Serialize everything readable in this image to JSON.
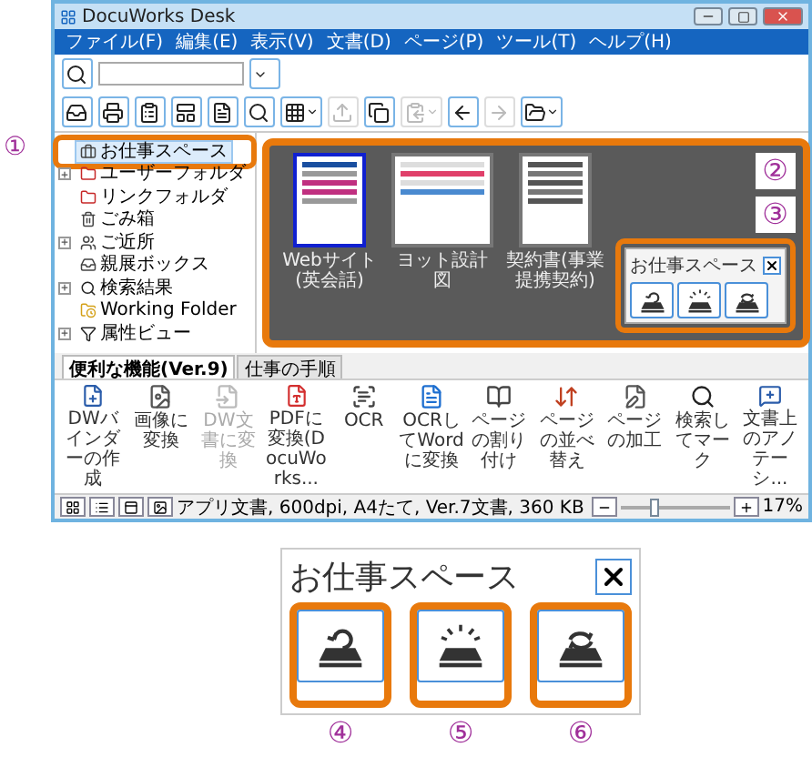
{
  "window": {
    "title": "DocuWorks Desk"
  },
  "menu": [
    "ファイル(F)",
    "編集(E)",
    "表示(V)",
    "文書(D)",
    "ページ(P)",
    "ツール(T)",
    "ヘルプ(H)"
  ],
  "toolbar": [
    {
      "kind": "tray",
      "disabled": false,
      "dropdown": false
    },
    {
      "kind": "print",
      "disabled": false,
      "dropdown": false
    },
    {
      "kind": "clipboard",
      "disabled": false,
      "dropdown": false
    },
    {
      "kind": "view",
      "disabled": false,
      "dropdown": false
    },
    {
      "kind": "page",
      "disabled": false,
      "dropdown": false
    },
    {
      "kind": "search",
      "disabled": false,
      "dropdown": false
    },
    {
      "kind": "grid",
      "disabled": false,
      "dropdown": true
    },
    {
      "kind": "upload",
      "disabled": true,
      "dropdown": false
    },
    {
      "kind": "copy",
      "disabled": false,
      "dropdown": false
    },
    {
      "kind": "paste",
      "disabled": true,
      "dropdown": true
    },
    {
      "kind": "back",
      "disabled": false,
      "dropdown": false
    },
    {
      "kind": "forward",
      "disabled": true,
      "dropdown": false
    },
    {
      "kind": "folder",
      "disabled": false,
      "dropdown": true
    }
  ],
  "tree": [
    {
      "label": "お仕事スペース",
      "kind": "workspace",
      "selected": true,
      "collapsed": false,
      "callout": "①"
    },
    {
      "label": "ユーザーフォルダ",
      "kind": "redfolder",
      "selected": false,
      "collapsed": true
    },
    {
      "label": "リンクフォルダ",
      "kind": "redfolder",
      "selected": false,
      "collapsed": false
    },
    {
      "label": "ごみ箱",
      "kind": "trash",
      "selected": false,
      "collapsed": false
    },
    {
      "label": "ご近所",
      "kind": "neighbors",
      "selected": false,
      "collapsed": true
    },
    {
      "label": "親展ボックス",
      "kind": "box",
      "selected": false,
      "collapsed": false
    },
    {
      "label": "検索結果",
      "kind": "search",
      "selected": false,
      "collapsed": true
    },
    {
      "label": "Working Folder",
      "kind": "working",
      "selected": false,
      "collapsed": false
    },
    {
      "label": "属性ビュー",
      "kind": "filter",
      "selected": false,
      "collapsed": true
    }
  ],
  "workspace": {
    "callout": "②",
    "documents": [
      {
        "title": "Webサイト(英会話)",
        "selected": true,
        "kind": "web"
      },
      {
        "title": "ヨット設計図",
        "selected": false,
        "kind": "drawing"
      },
      {
        "title": "契約書(事業提携契約)",
        "selected": false,
        "kind": "text"
      }
    ],
    "palette": {
      "callout": "③",
      "title": "お仕事スペース",
      "buttons": [
        {
          "kind": "return"
        },
        {
          "kind": "alert"
        },
        {
          "kind": "sync"
        }
      ]
    }
  },
  "tabs": [
    {
      "label": "便利な機能(Ver.9)",
      "selected": true
    },
    {
      "label": "仕事の手順",
      "selected": false
    }
  ],
  "ribbon": [
    {
      "label": "DWバインダーの作成",
      "kind": "binder",
      "disabled": false
    },
    {
      "label": "画像に変換",
      "kind": "image",
      "disabled": false
    },
    {
      "label": "DW文書に変換",
      "kind": "dw",
      "disabled": true
    },
    {
      "label": "PDFに変換(DocuWorks...",
      "kind": "pdf",
      "disabled": false
    },
    {
      "label": "OCR",
      "kind": "ocr",
      "disabled": false
    },
    {
      "label": "OCRしてWordに変換",
      "kind": "word",
      "disabled": false
    },
    {
      "label": "ページの割り付け",
      "kind": "layout",
      "disabled": false
    },
    {
      "label": "ページの並べ替え",
      "kind": "reorder",
      "disabled": false
    },
    {
      "label": "ページの加工",
      "kind": "edit",
      "disabled": false
    },
    {
      "label": "検索してマーク",
      "kind": "searchmark",
      "disabled": false
    },
    {
      "label": "文書上のアノテーシ...",
      "kind": "annotation",
      "disabled": false
    }
  ],
  "status": {
    "text": "アプリ文書, 600dpi, A4たて, Ver.7文書, 360 KB",
    "zoom": "17%",
    "level": 0.3
  },
  "enlarged_palette": {
    "title": "お仕事スペース",
    "buttons": [
      {
        "kind": "return",
        "callout": "④"
      },
      {
        "kind": "alert",
        "callout": "⑤"
      },
      {
        "kind": "sync",
        "callout": "⑥"
      }
    ]
  }
}
